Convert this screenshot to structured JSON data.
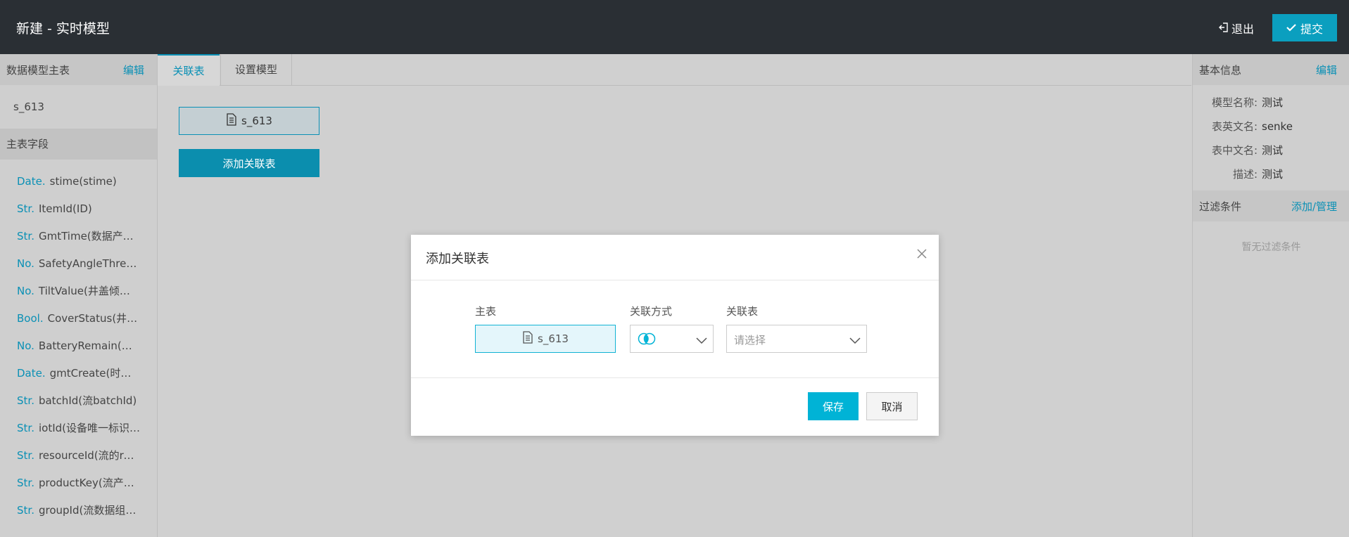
{
  "header": {
    "title": "新建 - 实时模型",
    "logout_label": "退出",
    "submit_label": "提交"
  },
  "left_panel": {
    "section_title": "数据模型主表",
    "edit_label": "编辑",
    "master_table": "s_613",
    "fields_title": "主表字段",
    "fields": [
      {
        "type": "Date.",
        "name": "stime(stime)"
      },
      {
        "type": "Str.",
        "name": "ItemId(ID)"
      },
      {
        "type": "Str.",
        "name": "GmtTime(数据产生…"
      },
      {
        "type": "No.",
        "name": "SafetyAngleThresh…"
      },
      {
        "type": "No.",
        "name": "TiltValue(井盖倾斜度)"
      },
      {
        "type": "Bool.",
        "name": "CoverStatus(井盖…"
      },
      {
        "type": "No.",
        "name": "BatteryRemain(电池…"
      },
      {
        "type": "Date.",
        "name": "gmtCreate(时间戳…"
      },
      {
        "type": "Str.",
        "name": "batchId(流batchId)"
      },
      {
        "type": "Str.",
        "name": "iotId(设备唯一标识…"
      },
      {
        "type": "Str.",
        "name": "resourceId(流的reso…"
      },
      {
        "type": "Str.",
        "name": "productKey(流产品k…"
      },
      {
        "type": "Str.",
        "name": "groupId(流数据组唯…"
      }
    ]
  },
  "tabs": [
    {
      "label": "关联表"
    },
    {
      "label": "设置模型"
    }
  ],
  "canvas": {
    "table_chip": "s_613",
    "add_table_label": "添加关联表"
  },
  "right_panel": {
    "info_title": "基本信息",
    "edit_label": "编辑",
    "info": [
      {
        "label": "模型名称:",
        "value": "测试"
      },
      {
        "label": "表英文名:",
        "value": "senke"
      },
      {
        "label": "表中文名:",
        "value": "测试"
      },
      {
        "label": "描述:",
        "value": "测试"
      }
    ],
    "filter_title": "过滤条件",
    "filter_action": "添加/管理",
    "filter_empty": "暂无过滤条件"
  },
  "modal": {
    "title": "添加关联表",
    "master_label": "主表",
    "master_value": "s_613",
    "join_label": "关联方式",
    "table_label": "关联表",
    "table_placeholder": "请选择",
    "save_label": "保存",
    "cancel_label": "取消"
  },
  "colors": {
    "accent": "#00b3d6",
    "link": "#0a90b5",
    "header_bg": "#2a2f34"
  }
}
